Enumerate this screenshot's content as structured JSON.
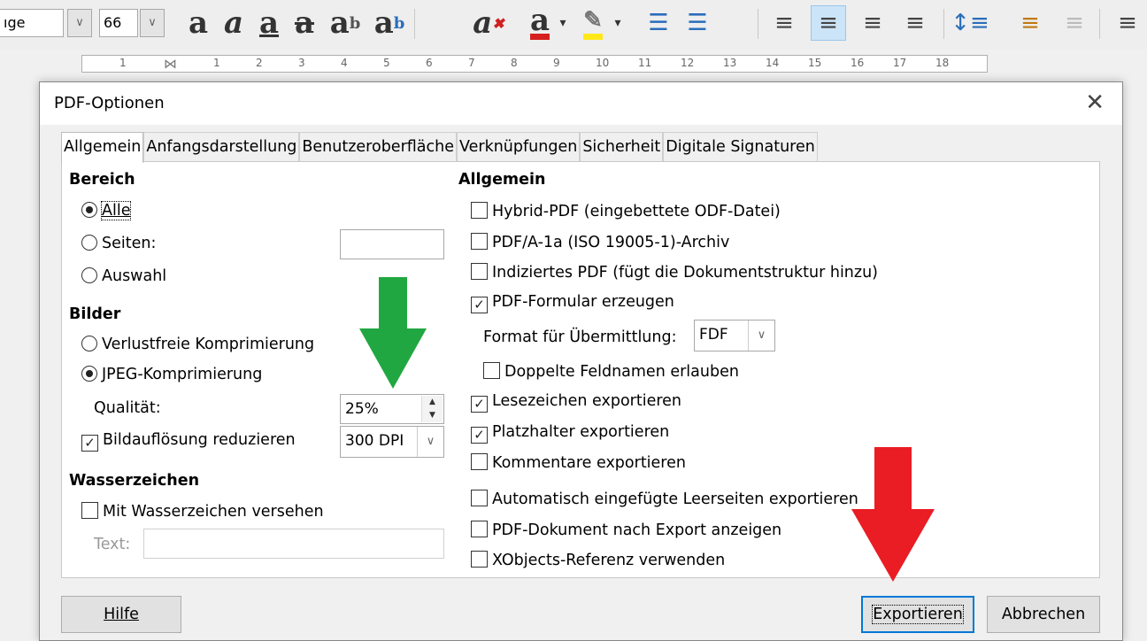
{
  "toolbar": {
    "paragraph_style_fragment": "ıge",
    "font_size": "66",
    "icons": [
      "bold-icon",
      "italic-icon",
      "underline-icon",
      "strikethrough-icon",
      "superscript-icon",
      "subscript-icon",
      "clear-formatting-icon",
      "font-color-icon",
      "highlight-icon",
      "bullets-icon",
      "numbering-icon",
      "align-left-icon",
      "align-center-icon",
      "align-right-icon",
      "justify-icon",
      "line-spacing-icon",
      "increase-paragraph-spacing-icon",
      "decrease-paragraph-spacing-icon",
      "increase-indent-icon"
    ]
  },
  "ruler": {
    "labels": [
      "1",
      "1",
      "2",
      "3",
      "4",
      "5",
      "6",
      "7",
      "8",
      "9",
      "10",
      "11",
      "12",
      "13",
      "14",
      "15",
      "16",
      "17",
      "18"
    ]
  },
  "dialog": {
    "title": "PDF-Optionen",
    "tabs": [
      "Allgemein",
      "Anfangsdarstellung",
      "Benutzeroberfläche",
      "Verknüpfungen",
      "Sicherheit",
      "Digitale Signaturen"
    ],
    "active_tab": "Allgemein",
    "left": {
      "bereich_heading": "Bereich",
      "range_options": [
        {
          "label": "Alle",
          "selected": true
        },
        {
          "label": "Seiten:",
          "selected": false
        },
        {
          "label": "Auswahl",
          "selected": false
        }
      ],
      "pages_value": "",
      "bilder_heading": "Bilder",
      "compression_options": [
        {
          "label": "Verlustfreie Komprimierung",
          "selected": false
        },
        {
          "label": "JPEG-Komprimierung",
          "selected": true
        }
      ],
      "quality_label": "Qualität:",
      "quality_value": "25%",
      "reduce_resolution_label": "Bildauflösung reduzieren",
      "reduce_resolution_checked": true,
      "resolution_value": "300 DPI",
      "watermark_heading": "Wasserzeichen",
      "watermark_label": "Mit Wasserzeichen versehen",
      "watermark_checked": false,
      "text_label": "Text:",
      "text_value": ""
    },
    "right": {
      "heading": "Allgemein",
      "options": [
        {
          "label": "Hybrid-PDF (eingebettete ODF-Datei)",
          "checked": false
        },
        {
          "label": "PDF/A-1a (ISO 19005-1)-Archiv",
          "checked": false
        },
        {
          "label": "Indiziertes PDF (fügt die Dokumentstruktur hinzu)",
          "checked": false
        },
        {
          "label": "PDF-Formular erzeugen",
          "checked": true
        }
      ],
      "format_label": "Format für Übermittlung:",
      "format_value": "FDF",
      "duplicate_fields": {
        "label": "Doppelte Feldnamen erlauben",
        "checked": false
      },
      "options2": [
        {
          "label": "Lesezeichen exportieren",
          "checked": true
        },
        {
          "label": "Platzhalter exportieren",
          "checked": true
        },
        {
          "label": "Kommentare exportieren",
          "checked": false
        }
      ],
      "options3": [
        {
          "label": "Automatisch eingefügte Leerseiten exportieren",
          "checked": false
        },
        {
          "label": "PDF-Dokument nach Export anzeigen",
          "checked": false
        },
        {
          "label": "XObjects-Referenz verwenden",
          "checked": false
        }
      ]
    },
    "buttons": {
      "help": "Hilfe",
      "export": "Exportieren",
      "cancel": "Abbrechen"
    }
  },
  "colors": {
    "green_arrow": "#21a741",
    "red_arrow": "#ea1c24",
    "accent": "#0078d7"
  }
}
